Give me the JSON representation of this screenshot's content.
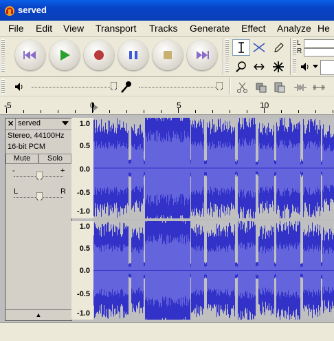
{
  "window": {
    "title": "served"
  },
  "menu": [
    "File",
    "Edit",
    "View",
    "Transport",
    "Tracks",
    "Generate",
    "Effect",
    "Analyze",
    "He"
  ],
  "transport": {
    "buttons": [
      "skip-start",
      "play",
      "record",
      "pause",
      "stop",
      "skip-end"
    ]
  },
  "meter": {
    "left_label": "L",
    "right_label": "R"
  },
  "ruler": {
    "labels": [
      "-5",
      "0",
      "5",
      "10"
    ]
  },
  "track": {
    "name": "served",
    "info_line1": "Stereo, 44100Hz",
    "info_line2": "16-bit PCM",
    "mute_label": "Mute",
    "solo_label": "Solo",
    "gain_minus": "-",
    "gain_plus": "+",
    "pan_left": "L",
    "pan_right": "R",
    "close_glyph": "✕",
    "collapse_glyph": "▲"
  },
  "amp_scale": [
    "1.0",
    "0.5",
    "0.0",
    "-0.5",
    "-1.0"
  ],
  "colors": {
    "waveform": "#3232c8",
    "waveform_rms": "#6464dc",
    "selection_bg": "#c0c0c0"
  }
}
